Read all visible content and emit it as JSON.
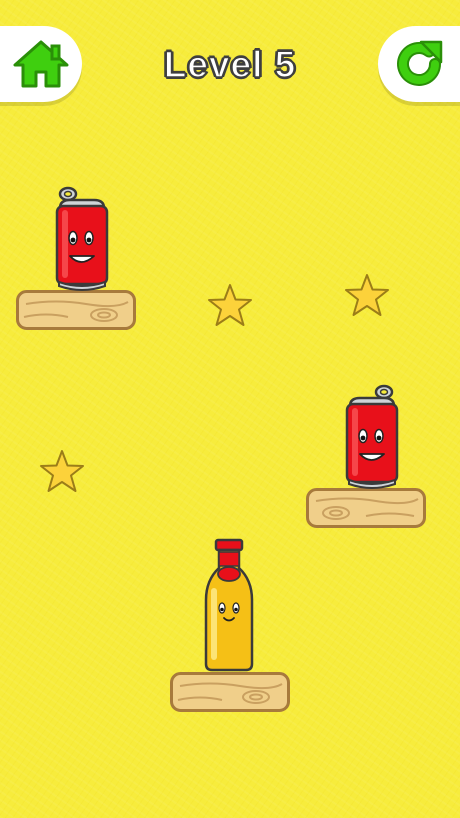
{
  "header": {
    "level_label": "Level 5"
  },
  "buttons": {
    "home_icon": "home-icon",
    "restart_icon": "restart-icon"
  },
  "colors": {
    "background": "#f7ec3c",
    "button_green": "#3fcf0f",
    "can_red": "#e8101a",
    "bottle_yellow": "#f5c016",
    "wood": "#f0cf8a",
    "star": "#fcd23a"
  },
  "scene": {
    "platforms": 3,
    "cans": 2,
    "bottles": 1,
    "stars": 3
  }
}
